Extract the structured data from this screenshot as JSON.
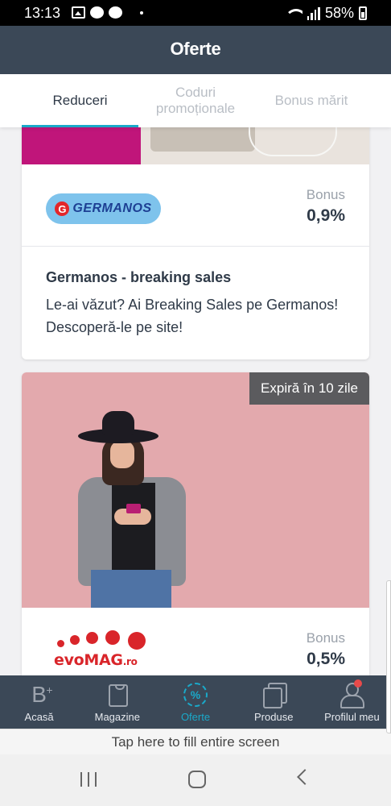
{
  "status_bar": {
    "time": "13:13",
    "battery": "58%",
    "icons": [
      "gallery-icon",
      "messenger-icon",
      "messenger-icon",
      "dot-icon",
      "wifi-icon",
      "signal-icon",
      "battery-icon"
    ]
  },
  "header": {
    "title": "Oferte"
  },
  "tabs": [
    {
      "label": "Reduceri",
      "active": true
    },
    {
      "label": "Coduri promoționale",
      "active": false
    },
    {
      "label": "Bonus mărit",
      "active": false
    }
  ],
  "offers": [
    {
      "brand": "GERMANOS",
      "bonus_label": "Bonus",
      "bonus_value": "0,9%",
      "title": "Germanos - breaking sales",
      "description": "Le-ai văzut? Ai Breaking Sales pe Germanos! Descoperă-le pe site!"
    },
    {
      "brand": "evoMAG.ro",
      "brand_main": "evoMAG",
      "brand_suffix": ".ro",
      "expiry": "Expiră în 10 zile",
      "bonus_label": "Bonus",
      "bonus_value": "0,5%"
    }
  ],
  "bottom_nav": [
    {
      "label": "Acasă",
      "icon": "home-b-icon",
      "active": false
    },
    {
      "label": "Magazine",
      "icon": "shopping-bag-icon",
      "active": false
    },
    {
      "label": "Oferte",
      "icon": "percent-badge-icon",
      "active": true
    },
    {
      "label": "Produse",
      "icon": "products-icon",
      "active": false
    },
    {
      "label": "Profilul meu",
      "icon": "profile-icon",
      "active": false,
      "notification": true
    }
  ],
  "fill_screen": {
    "label": "Tap here to fill entire screen"
  },
  "colors": {
    "header_bg": "#3b4857",
    "accent": "#1aa9c9",
    "notification": "#e84a4a"
  }
}
